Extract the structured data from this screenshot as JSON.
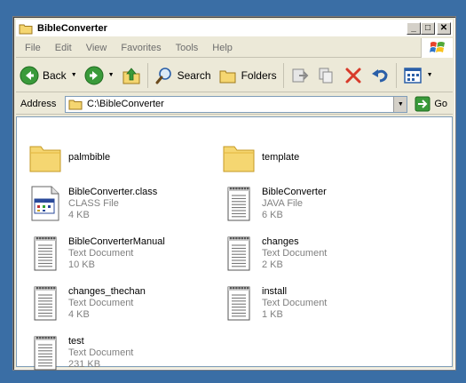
{
  "window": {
    "title": "BibleConverter",
    "buttons": {
      "minimize": "_",
      "maximize": "□",
      "close": "✕"
    }
  },
  "menu": [
    "File",
    "Edit",
    "View",
    "Favorites",
    "Tools",
    "Help"
  ],
  "toolbar": {
    "back": "Back",
    "search": "Search",
    "folders": "Folders"
  },
  "address": {
    "label": "Address",
    "path": "C:\\BibleConverter",
    "go": "Go"
  },
  "files": [
    {
      "name": "palmbible",
      "type": "",
      "size": "",
      "kind": "folder"
    },
    {
      "name": "template",
      "type": "",
      "size": "",
      "kind": "folder"
    },
    {
      "name": "BibleConverter.class",
      "type": "CLASS File",
      "size": "4 KB",
      "kind": "class"
    },
    {
      "name": "BibleConverter",
      "type": "JAVA File",
      "size": "6 KB",
      "kind": "text"
    },
    {
      "name": "BibleConverterManual",
      "type": "Text Document",
      "size": "10 KB",
      "kind": "text"
    },
    {
      "name": "changes",
      "type": "Text Document",
      "size": "2 KB",
      "kind": "text"
    },
    {
      "name": "changes_thechan",
      "type": "Text Document",
      "size": "4 KB",
      "kind": "text"
    },
    {
      "name": "install",
      "type": "Text Document",
      "size": "1 KB",
      "kind": "text"
    },
    {
      "name": "test",
      "type": "Text Document",
      "size": "231 KB",
      "kind": "text"
    }
  ],
  "colors": {
    "desktop": "#3a6ea5",
    "folder": "#f5d671",
    "go_green": "#3a9a3a",
    "delete_red": "#d83a2a"
  }
}
